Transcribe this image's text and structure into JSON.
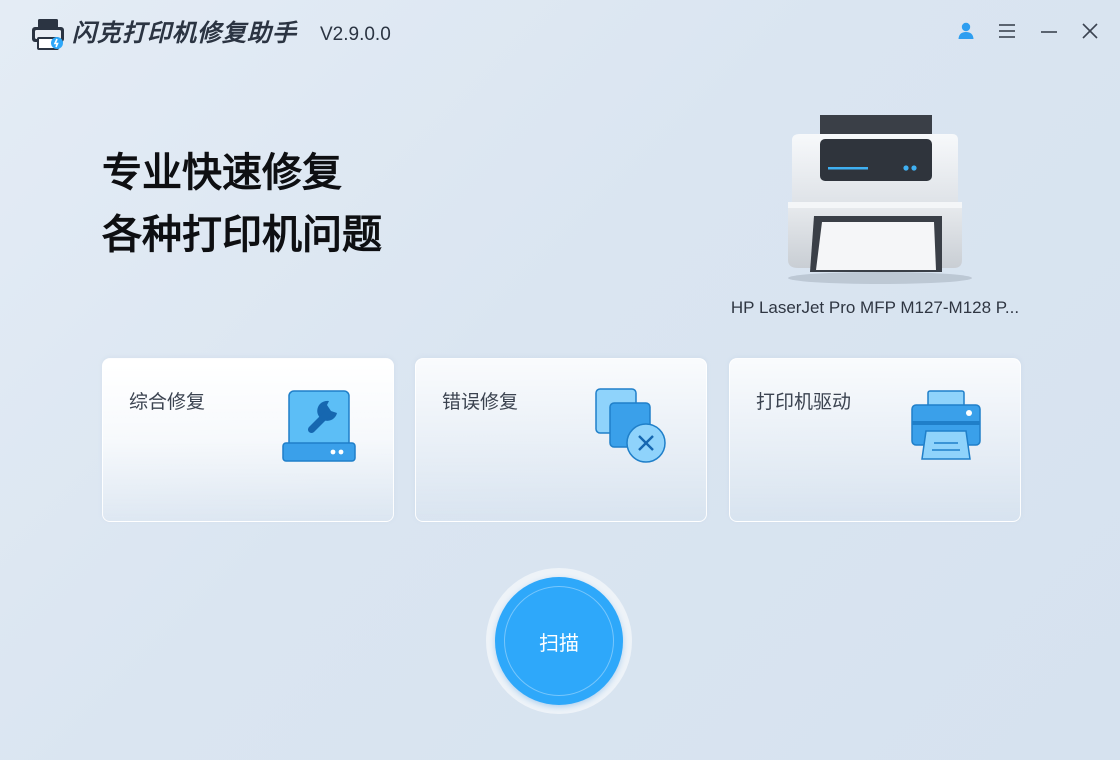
{
  "app": {
    "title": "闪克打印机修复助手",
    "version": "V2.9.0.0"
  },
  "window_controls": {
    "user_icon": "user-icon",
    "menu_icon": "menu-icon",
    "minimize_icon": "minimize-icon",
    "close_icon": "close-icon"
  },
  "headline": {
    "line1": "专业快速修复",
    "line2": "各种打印机问题"
  },
  "printer": {
    "name": "HP LaserJet Pro MFP M127-M128 P..."
  },
  "cards": [
    {
      "label": "综合修复",
      "icon": "wrench-disk-icon"
    },
    {
      "label": "错误修复",
      "icon": "error-stack-icon"
    },
    {
      "label": "打印机驱动",
      "icon": "printer-icon"
    }
  ],
  "scan": {
    "label": "扫描"
  },
  "colors": {
    "accent": "#2ea8fa",
    "icon_blue": "#3aa0ea",
    "text_dark": "#0e0f12"
  }
}
